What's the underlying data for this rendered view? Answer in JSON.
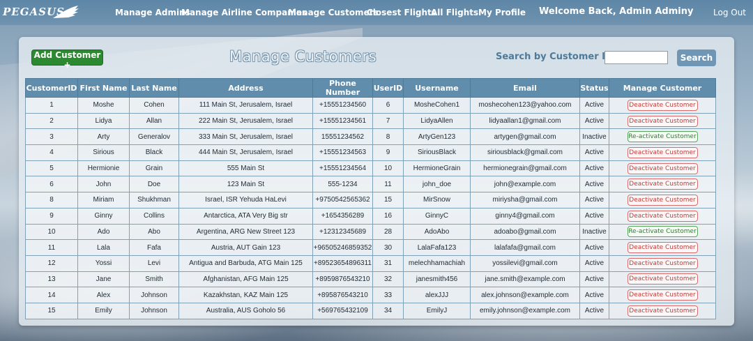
{
  "navbar": {
    "logo_text": "PEGASUS",
    "links": [
      "Manage Admins",
      "Manage Airline Companies",
      "Manage Customers",
      "Closest Flights",
      "All Flights",
      "My Profile"
    ],
    "welcome": "Welcome Back, Admin Adminy",
    "logout": "Log Out"
  },
  "page": {
    "title": "Manage Customers",
    "add_button": "Add Customer +",
    "search_label": "Search by Customer ID:",
    "search_value": "",
    "search_button": "Search"
  },
  "table": {
    "headers": [
      "CustomerID",
      "First Name",
      "Last Name",
      "Address",
      "Phone Number",
      "UserID",
      "Username",
      "Email",
      "Status",
      "Manage Customer"
    ],
    "rows": [
      {
        "id": "1",
        "first": "Moshe",
        "last": "Cohen",
        "address": "111 Main St, Jerusalem, Israel",
        "phone": "+15551234560",
        "userid": "6",
        "username": "MosheCohen1",
        "email": "moshecohen123@yahoo.com",
        "status": "Active",
        "action": "Deactivate Customer"
      },
      {
        "id": "2",
        "first": "Lidya",
        "last": "Allan",
        "address": "222 Main St, Jerusalem, Israel",
        "phone": "+15551234561",
        "userid": "7",
        "username": "LidyaAllen",
        "email": "lidyaallan1@gmail.com",
        "status": "Active",
        "action": "Deactivate Customer"
      },
      {
        "id": "3",
        "first": "Arty",
        "last": "Generalov",
        "address": "333 Main St, Jerusalem, Israel",
        "phone": "15551234562",
        "userid": "8",
        "username": "ArtyGen123",
        "email": "artygen@gmail.com",
        "status": "Inactive",
        "action": "Re-activate Customer"
      },
      {
        "id": "4",
        "first": "Sirious",
        "last": "Black",
        "address": "444 Main St, Jerusalem, Israel",
        "phone": "+15551234563",
        "userid": "9",
        "username": "SiriousBlack",
        "email": "siriousblack@gmail.com",
        "status": "Active",
        "action": "Deactivate Customer"
      },
      {
        "id": "5",
        "first": "Hermionie",
        "last": "Grain",
        "address": "555 Main St",
        "phone": "+15551234564",
        "userid": "10",
        "username": "HermioneGrain",
        "email": "hermionegrain@gmail.com",
        "status": "Active",
        "action": "Deactivate Customer"
      },
      {
        "id": "6",
        "first": "John",
        "last": "Doe",
        "address": "123 Main St",
        "phone": "555-1234",
        "userid": "11",
        "username": "john_doe",
        "email": "john@example.com",
        "status": "Active",
        "action": "Deactivate Customer"
      },
      {
        "id": "8",
        "first": "Miriam",
        "last": "Shukhman",
        "address": "Israel, ISR Yehuda HaLevi",
        "phone": "+9750542565362",
        "userid": "15",
        "username": "MirSnow",
        "email": "miriysha@gmail.com",
        "status": "Active",
        "action": "Deactivate Customer"
      },
      {
        "id": "9",
        "first": "Ginny",
        "last": "Collins",
        "address": "Antarctica, ATA Very Big str",
        "phone": "+1654356289",
        "userid": "16",
        "username": "GinnyC",
        "email": "ginny4@gmail.com",
        "status": "Active",
        "action": "Deactivate Customer"
      },
      {
        "id": "10",
        "first": "Ado",
        "last": "Abo",
        "address": "Argentina, ARG New Street 123",
        "phone": "+12312345689",
        "userid": "28",
        "username": "AdoAbo",
        "email": "adoabo@gmail.com",
        "status": "Inactive",
        "action": "Re-activate Customer"
      },
      {
        "id": "11",
        "first": "Lala",
        "last": "Fafa",
        "address": "Austria, AUT Gain 123",
        "phone": "+96505246859352",
        "userid": "30",
        "username": "LalaFafa123",
        "email": "lalafafa@gmail.com",
        "status": "Active",
        "action": "Deactivate Customer"
      },
      {
        "id": "12",
        "first": "Yossi",
        "last": "Levi",
        "address": "Antigua and Barbuda, ATG Main 125",
        "phone": "+89523654896311",
        "userid": "31",
        "username": "melechhamachiah",
        "email": "yossilevi@gmail.com",
        "status": "Active",
        "action": "Deactivate Customer"
      },
      {
        "id": "13",
        "first": "Jane",
        "last": "Smith",
        "address": "Afghanistan, AFG Main 125",
        "phone": "+8959876543210",
        "userid": "32",
        "username": "janesmith456",
        "email": "jane.smith@example.com",
        "status": "Active",
        "action": "Deactivate Customer"
      },
      {
        "id": "14",
        "first": "Alex",
        "last": "Johnson",
        "address": "Kazakhstan, KAZ Main 125",
        "phone": "+895876543210",
        "userid": "33",
        "username": "alexJJJ",
        "email": "alex.johnson@example.com",
        "status": "Active",
        "action": "Deactivate Customer"
      },
      {
        "id": "15",
        "first": "Emily",
        "last": "Johnson",
        "address": "Australia, AUS Goholo 56",
        "phone": "+569765432109",
        "userid": "34",
        "username": "EmilyJ",
        "email": "emily.johnson@example.com",
        "status": "Active",
        "action": "Deactivate Customer"
      }
    ]
  },
  "colors": {
    "navbar": "#6f93b0",
    "add_button": "#2b8a2f",
    "table_header": "#5f8dab",
    "deactivate": "#c23a3a",
    "reactivate": "#2f7d31"
  }
}
